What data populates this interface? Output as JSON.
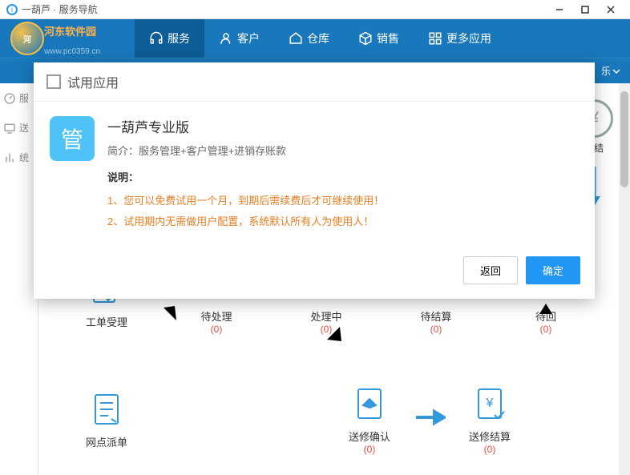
{
  "window": {
    "title": "一葫芦 · 服务导航"
  },
  "brand": {
    "name": "河东软件园",
    "url": "www.pc0359.cn"
  },
  "menu": {
    "items": [
      {
        "label": "服务",
        "icon": "headset"
      },
      {
        "label": "客户",
        "icon": "user"
      },
      {
        "label": "仓库",
        "icon": "home"
      },
      {
        "label": "销售",
        "icon": "cube"
      },
      {
        "label": "更多应用",
        "icon": "grid"
      }
    ],
    "active": 0
  },
  "subbar": {
    "dropdown": "乐"
  },
  "sidebar": {
    "items": [
      {
        "label": "服",
        "icon": "dashboard"
      },
      {
        "label": "送",
        "icon": "screen"
      },
      {
        "label": "统",
        "icon": "bars"
      }
    ]
  },
  "dialog": {
    "header": "试用应用",
    "icon_text": "管",
    "app_name": "一葫芦专业版",
    "desc": "简介：服务管理+客户管理+进销存账款",
    "explain_label": "说明：",
    "lines": [
      "1、您可以免费试用一个月，到期后需续费后才可继续使用！",
      "2、试用期内无需做用户配置，系统默认所有人为使用人！"
    ],
    "btn_back": "返回",
    "btn_ok": "确定"
  },
  "workflow": {
    "right": {
      "label": "待结",
      "label2": "待回"
    },
    "top": [
      {
        "label": "工单受理",
        "count": ""
      },
      {
        "label": "待处理",
        "count": "(0)"
      },
      {
        "label": "处理中",
        "count": "(0)"
      },
      {
        "label": "待结算",
        "count": "(0)"
      },
      {
        "label": "待回",
        "count": "(0)"
      }
    ],
    "bot": [
      {
        "label": "网点派单",
        "count": ""
      },
      {
        "label": "送修确认",
        "count": "(0)"
      },
      {
        "label": "送修结算",
        "count": "(0)"
      }
    ]
  }
}
